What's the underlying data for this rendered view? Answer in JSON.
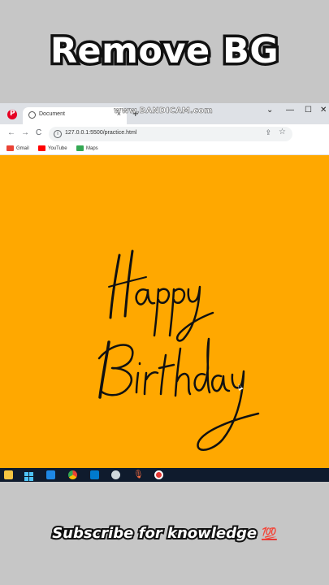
{
  "headline": "Remove BG",
  "browser": {
    "tab_title": "Document",
    "tab_close": "×",
    "new_tab": "+",
    "watermark": "www.BANDICAM.com",
    "window_controls": {
      "minimize": "—",
      "maximize": "☐",
      "close": "✕"
    },
    "url": "127.0.0.1:5500/practice.html",
    "nav": {
      "back": "←",
      "forward": "→",
      "reload": "C"
    },
    "bookmarks": [
      {
        "label": "Gmail",
        "icon": "gmail-icon",
        "color": "#ea4335"
      },
      {
        "label": "YouTube",
        "icon": "youtube-icon",
        "color": "#ff0000"
      },
      {
        "label": "Maps",
        "icon": "maps-icon",
        "color": "#34a853"
      }
    ],
    "page": {
      "background": "#ffa800",
      "lettering_line1": "Happy",
      "lettering_line2": "Birthday"
    }
  },
  "taskbar": {
    "icons": [
      "file-explorer-icon",
      "start-icon",
      "mail-icon",
      "chrome-icon",
      "vscode-icon",
      "app-icon",
      "microphone-icon",
      "record-icon"
    ]
  },
  "footer": {
    "text": "Subscribe for knowledge",
    "emoji": "💯"
  }
}
